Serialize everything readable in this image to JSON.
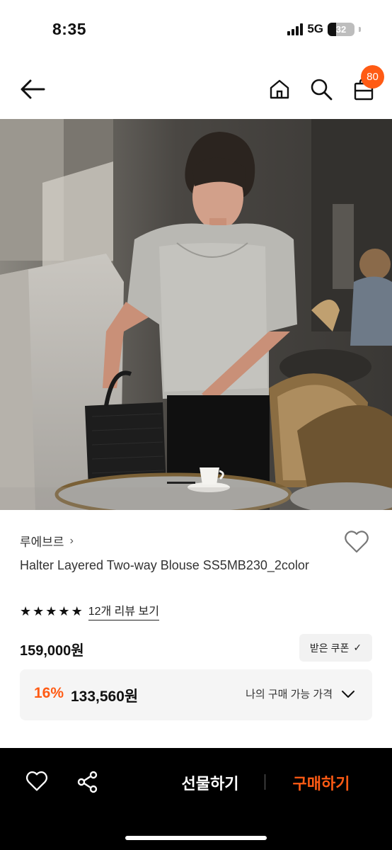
{
  "status_bar": {
    "time": "8:35",
    "network": "5G",
    "battery": "32",
    "battery_level": 0.32
  },
  "header": {
    "icons": [
      "back-arrow-icon",
      "home-icon",
      "search-icon",
      "shopping-bag-icon"
    ],
    "cart_count": "80"
  },
  "hero": {
    "description_icon": "product-photo"
  },
  "product": {
    "brand": "루에브르",
    "brand_chevron": "›",
    "name": "Halter Layered Two-way Blouse SS5MB230_2color",
    "rating_stars": 5,
    "review_link": "12개 리뷰 보기",
    "price": "159,000원",
    "coupon_button": "받은 쿠폰",
    "coupon_check": "✓",
    "discount_rate": "16%",
    "discount_price": "133,560원",
    "my_price_label": "나의 구매 가능 가격"
  },
  "bottom_bar": {
    "gift_label": "선물하기",
    "buy_label": "구매하기"
  },
  "colors": {
    "accent": "#ff5b14",
    "bottom_bar": "#000000"
  }
}
